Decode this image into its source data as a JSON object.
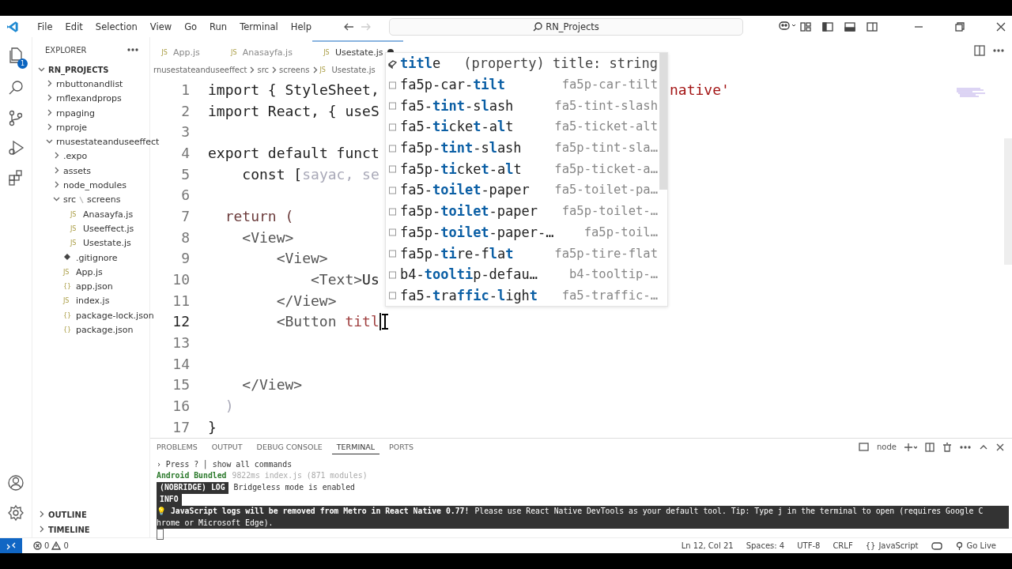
{
  "window": {
    "title": "RN_Projects"
  },
  "menu": [
    "File",
    "Edit",
    "Selection",
    "View",
    "Go",
    "Run",
    "Terminal",
    "Help"
  ],
  "activity_bar": {
    "badge": "1"
  },
  "sidebar": {
    "title": "EXPLORER",
    "root": "RN_PROJECTS",
    "tree": [
      {
        "label": "rnbuttonandlist",
        "kind": "folder",
        "expanded": false
      },
      {
        "label": "rnflexandprops",
        "kind": "folder",
        "expanded": false
      },
      {
        "label": "rnpaging",
        "kind": "folder",
        "expanded": false
      },
      {
        "label": "rnproje",
        "kind": "folder",
        "expanded": false
      },
      {
        "label": "rnusestateanduseeffect",
        "kind": "folder",
        "expanded": true,
        "children": [
          {
            "label": ".expo",
            "kind": "folder",
            "expanded": false
          },
          {
            "label": "assets",
            "kind": "folder",
            "expanded": false
          },
          {
            "label": "node_modules",
            "kind": "folder",
            "expanded": false
          },
          {
            "label": "src",
            "compact_child": "screens",
            "kind": "folder",
            "expanded": true,
            "children": [
              {
                "label": "Anasayfa.js",
                "kind": "file",
                "icon_text": "JS"
              },
              {
                "label": "Useeffect.js",
                "kind": "file",
                "icon_text": "JS"
              },
              {
                "label": "Usestate.js",
                "kind": "file",
                "icon_text": "JS"
              }
            ]
          },
          {
            "label": ".gitignore",
            "kind": "git"
          },
          {
            "label": "App.js",
            "kind": "file",
            "icon_text": "JS"
          },
          {
            "label": "app.json",
            "kind": "file",
            "icon_text": "{}"
          },
          {
            "label": "index.js",
            "kind": "file",
            "icon_text": "JS"
          },
          {
            "label": "package-lock.json",
            "kind": "file",
            "icon_text": "{}"
          },
          {
            "label": "package.json",
            "kind": "file",
            "icon_text": "{}"
          }
        ]
      }
    ],
    "sections": [
      "OUTLINE",
      "TIMELINE"
    ]
  },
  "tabs": [
    {
      "label": "App.js",
      "icon_text": "JS",
      "selected": false,
      "modified": false
    },
    {
      "label": "Anasayfa.js",
      "icon_text": "JS",
      "selected": false,
      "modified": false
    },
    {
      "label": "Usestate.js",
      "icon_text": "JS",
      "selected": true,
      "modified": true
    }
  ],
  "breadcrumb": [
    {
      "label": "rnusestateanduseeffect"
    },
    {
      "label": "src"
    },
    {
      "label": "screens"
    },
    {
      "label": "Usestate.js",
      "icon_text": "JS"
    }
  ],
  "editor": {
    "lines": [
      {
        "number": "1",
        "tokens": [
          {
            "text": "import { StyleSheet,",
            "kind": "plain"
          }
        ],
        "tail": "native'"
      },
      {
        "number": "2",
        "tokens": [
          {
            "text": "import React, { useS",
            "kind": "plain"
          }
        ]
      },
      {
        "number": "3"
      },
      {
        "number": "4",
        "tokens": [
          {
            "text": "export default funct",
            "kind": "plain"
          }
        ]
      },
      {
        "number": "5",
        "tokens": [
          {
            "text": "    const [",
            "kind": "plain"
          },
          {
            "text": "sayac, se",
            "kind": "faded"
          }
        ]
      },
      {
        "number": "6"
      },
      {
        "number": "7",
        "tokens": [
          {
            "text": "  return (",
            "kind": "keyword"
          }
        ]
      },
      {
        "number": "8",
        "tokens": [
          {
            "text": "    <View>",
            "kind": "tag"
          }
        ]
      },
      {
        "number": "9",
        "tokens": [
          {
            "text": "        <View>",
            "kind": "tag"
          }
        ]
      },
      {
        "number": "10",
        "tokens": [
          {
            "text": "            <Text>",
            "kind": "tag"
          },
          {
            "text": "Us",
            "kind": "plain"
          }
        ]
      },
      {
        "number": "11",
        "tokens": [
          {
            "text": "        </View>",
            "kind": "tag"
          }
        ]
      },
      {
        "number": "12",
        "tokens": [
          {
            "text": "        <Button",
            "kind": "tag"
          },
          {
            "text": " titl",
            "kind": "attr"
          }
        ],
        "cursor": true
      },
      {
        "number": "13"
      },
      {
        "number": "14"
      },
      {
        "number": "15",
        "tokens": [
          {
            "text": "    </View>",
            "kind": "tag"
          }
        ]
      },
      {
        "number": "16",
        "tokens": [
          {
            "text": "  )",
            "kind": "faded"
          }
        ]
      },
      {
        "number": "17",
        "tokens": [
          {
            "text": "}",
            "kind": "plain"
          }
        ]
      }
    ]
  },
  "suggestions": [
    {
      "label": "**titl**e",
      "detail": "(property) title: string",
      "kind": "property"
    },
    {
      "label": "fa5p-car-**tilt**",
      "detail": "fa5p-car-tilt",
      "kind": "snippet"
    },
    {
      "label": "fa5-**tint**-s**l**ash",
      "detail": "fa5-tint-slash",
      "kind": "snippet"
    },
    {
      "label": "fa5-**ti**cke**t**-a**l**t",
      "detail": "fa5-ticket-alt",
      "kind": "snippet"
    },
    {
      "label": "fa5p-**tint**-s**l**ash",
      "detail": "fa5p-tint-sla…",
      "kind": "snippet"
    },
    {
      "label": "fa5p-**ti**cke**t**-a**l**t",
      "detail": "fa5p-ticket-a…",
      "kind": "snippet"
    },
    {
      "label": "fa5-**toilet**-paper",
      "detail": "fa5-toilet-pa…",
      "kind": "snippet"
    },
    {
      "label": "fa5p-**toilet**-paper",
      "detail": "fa5p-toilet-…",
      "kind": "snippet"
    },
    {
      "label": "fa5p-**toilet**-paper-…",
      "detail": "fa5p-toil…",
      "kind": "snippet"
    },
    {
      "label": "fa5p-**ti**re-f**l**a**t**",
      "detail": "fa5p-tire-flat",
      "kind": "snippet"
    },
    {
      "label": "b4-**toolti**p-defau…",
      "detail": "b4-tooltip-…",
      "kind": "snippet"
    },
    {
      "label": "fa5-**t**ra**ffic**-**l**igh**t**",
      "detail": "fa5-traffic-…",
      "kind": "snippet"
    }
  ],
  "panel": {
    "tabs": [
      {
        "label": "PROBLEMS",
        "selected": false
      },
      {
        "label": "OUTPUT",
        "selected": false
      },
      {
        "label": "DEBUG CONSOLE",
        "selected": false
      },
      {
        "label": "TERMINAL",
        "selected": true
      },
      {
        "label": "PORTS",
        "selected": false
      }
    ],
    "terminal_name": "node",
    "lines": [
      {
        "selected": false,
        "segments": [
          {
            "text": "› Press ? │ show all commands",
            "kind": "plain"
          }
        ]
      },
      {
        "selected": false,
        "segments": [
          {
            "text": "Android Bundled",
            "kind": "green"
          },
          {
            "text": "9822ms index.js (871 modules)",
            "kind": "dim"
          }
        ]
      },
      {
        "selected": false,
        "segments": [
          {
            "text": "(NOBRIDGE) LOG",
            "kind": "badge"
          },
          {
            "text": "Bridgeless mode is enabled",
            "kind": "plain"
          }
        ]
      },
      {
        "selected": false,
        "segments": [
          {
            "text": "INFO",
            "kind": "badge"
          }
        ]
      },
      {
        "selected": true,
        "segments": [
          {
            "text": "💡 JavaScript logs will be removed from Metro in React Native 0.77!",
            "kind": "bold"
          },
          {
            "text": "Please use React Native DevTools as your default tool. Tip: Type j in the terminal to open (requires Google C",
            "kind": "plain"
          }
        ]
      },
      {
        "selected": true,
        "segments": [
          {
            "text": "hrome or Microsoft Edge).",
            "kind": "plain"
          }
        ]
      }
    ]
  },
  "status_bar": {
    "errors": "0",
    "warnings": "0",
    "items": [
      {
        "label": "Ln 12, Col 21"
      },
      {
        "label": "Spaces: 4"
      },
      {
        "label": "UTF-8"
      },
      {
        "label": "CRLF"
      },
      {
        "label": "JavaScript",
        "icon_text": "{}"
      },
      {
        "label": "Go Live"
      }
    ]
  }
}
